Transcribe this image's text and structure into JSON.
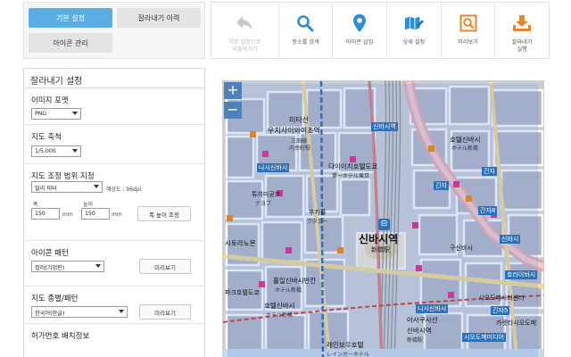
{
  "tabs": {
    "basic": "기본 설정",
    "history": "잘라내기 이력",
    "icon_manage": "아이콘 관리"
  },
  "toolbar": {
    "reset": "기본 설정으로\n되돌아가기",
    "search": "장소를 검색",
    "icon_insert": "아이콘 삽입",
    "detail": "상세 설정",
    "preview": "미리보기",
    "crop_run": "잘라내기\n실행"
  },
  "panel": {
    "title": "잘라내기 설정",
    "image_format": {
      "label": "이미지 포맷",
      "value": "PNG"
    },
    "map_scale": {
      "label": "지도 축척",
      "value": "1/5,000"
    },
    "range": {
      "label": "지도 조정 범위 지정",
      "unit": "밀리 미터",
      "resolution": "해상도 : 96dpi",
      "width_label": "폭",
      "height_label": "높이",
      "width_value": "150",
      "height_value": "150",
      "mm1": "mm",
      "mm2": "mm",
      "ratio_button": "폭 높이 조정"
    },
    "icon_pattern": {
      "label": "아이콘 패턴",
      "value": "컬러(기업판)",
      "preview": "미리보기"
    },
    "map_type": {
      "label": "지도 종별/패턴",
      "value": "한국어(한글)",
      "preview": "미리보기"
    },
    "license": {
      "label": "허가번호 배치정보"
    }
  },
  "map": {
    "zoom_in": "+",
    "zoom_out": "−",
    "station_ko": "신바시역",
    "station_ja": "新橋駅",
    "labels": [
      {
        "ko": "미타선",
        "ja": ""
      },
      {
        "ko": "우치사이와이초역",
        "ja": ""
      },
      {
        "ko": "三田線",
        "ja": ""
      },
      {
        "ko": "内幸町駅",
        "ja": ""
      },
      {
        "ko": "신바시역",
        "ja": ""
      },
      {
        "ko": "호텔신바시",
        "ja": "ホテル新橋"
      },
      {
        "ko": "나시신바시",
        "ja": ""
      },
      {
        "ko": "다이이치호텔도쿄",
        "ja": "第一ホテル東京"
      },
      {
        "ko": "긴자",
        "ja": ""
      },
      {
        "ko": "긴자",
        "ja": ""
      },
      {
        "ko": "튜히미공프",
        "ja": "ナヨブ"
      },
      {
        "ko": "간자8",
        "ja": ""
      },
      {
        "ko": "후카클",
        "ja": "クタヨー"
      },
      {
        "ko": "시토라노몬",
        "ja": ""
      },
      {
        "ko": "신바시",
        "ja": ""
      },
      {
        "ko": "구신바시",
        "ja": ""
      },
      {
        "ko": "홀일신바시반칸",
        "ja": "ホテル新橋"
      },
      {
        "ko": "호텔신바시",
        "ja": "ホテル新橋"
      },
      {
        "ko": "파크호텔도쿄",
        "ja": ""
      },
      {
        "ko": "호라이바시",
        "ja": ""
      },
      {
        "ko": "시오도메시티센터",
        "ja": ""
      },
      {
        "ko": "긴자5",
        "ja": ""
      },
      {
        "ko": "카렛타시오도메",
        "ja": ""
      },
      {
        "ko": "니시신바시",
        "ja": ""
      },
      {
        "ko": "아사쿠사선",
        "ja": ""
      },
      {
        "ko": "신바시역",
        "ja": "新橋駅"
      },
      {
        "ko": "시오도메미디어",
        "ja": ""
      },
      {
        "ko": "레인보우호텔",
        "ja": "レインボーホテル"
      }
    ]
  },
  "colors": {
    "tab_active": "#5aaee2",
    "map_water": "#c4dced",
    "map_block": "#b3b9c4",
    "map_road": "#ffffff",
    "map_rail": "#e07b7b",
    "map_highway": "#e8a0a0",
    "map_overlay": "#8aa3e0",
    "zoom_button": "#4f81b8"
  }
}
